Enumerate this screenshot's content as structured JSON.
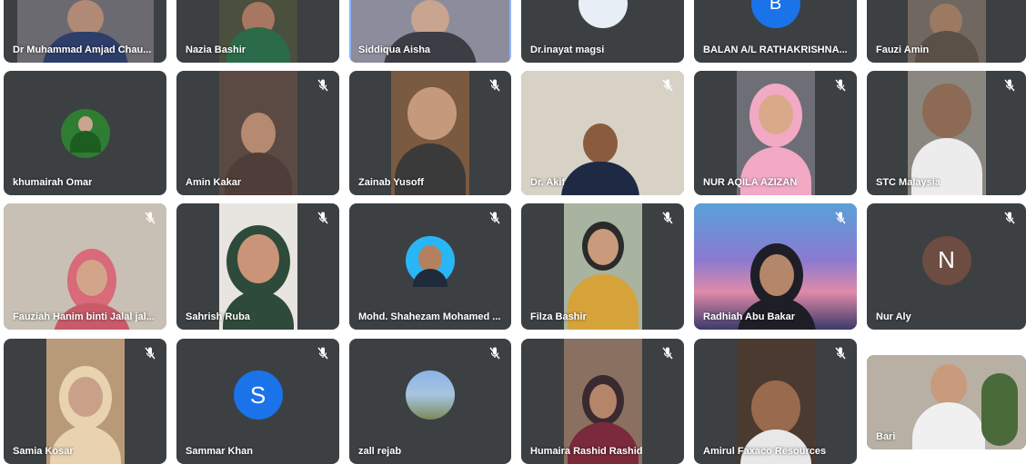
{
  "participants": [
    {
      "name": "Dr Muhammad Amjad Chau..."
    },
    {
      "name": "Nazia Bashir"
    },
    {
      "name": "Siddiqua Aisha"
    },
    {
      "name": "Dr.inayat magsi"
    },
    {
      "name": "BALAN A/L RATHAKRISHNA..."
    },
    {
      "name": "Fauzi Amin"
    },
    {
      "name": "khumairah Omar"
    },
    {
      "name": "Amin Kakar"
    },
    {
      "name": "Zainab Yusoff"
    },
    {
      "name": "Dr. Akif"
    },
    {
      "name": "NUR AQILA AZIZAN"
    },
    {
      "name": "STC Malaysia"
    },
    {
      "name": "Fauziah Hanim binti Jalal jal..."
    },
    {
      "name": "Sahrish Ruba"
    },
    {
      "name": "Mohd. Shahezam Mohamed ..."
    },
    {
      "name": "Filza Bashir"
    },
    {
      "name": "Radhiah Abu Bakar"
    },
    {
      "name": "Nur Aly",
      "initial": "N"
    },
    {
      "name": "Samia Kosar"
    },
    {
      "name": "Sammar Khan",
      "initial": "S"
    },
    {
      "name": "zall rejab"
    },
    {
      "name": "Humaira Rashid Rashid"
    },
    {
      "name": "Amirul Faxaco Resources"
    },
    {
      "name": "Bari"
    }
  ],
  "colors": {
    "tile_bg": "#3c4043",
    "active_outline": "#8ab4f8",
    "avatar_n": "#6d4c41",
    "avatar_s": "#1a73e8",
    "avatar_b": "#1a73e8"
  },
  "icons": {
    "mute": "microphone-off-icon"
  }
}
